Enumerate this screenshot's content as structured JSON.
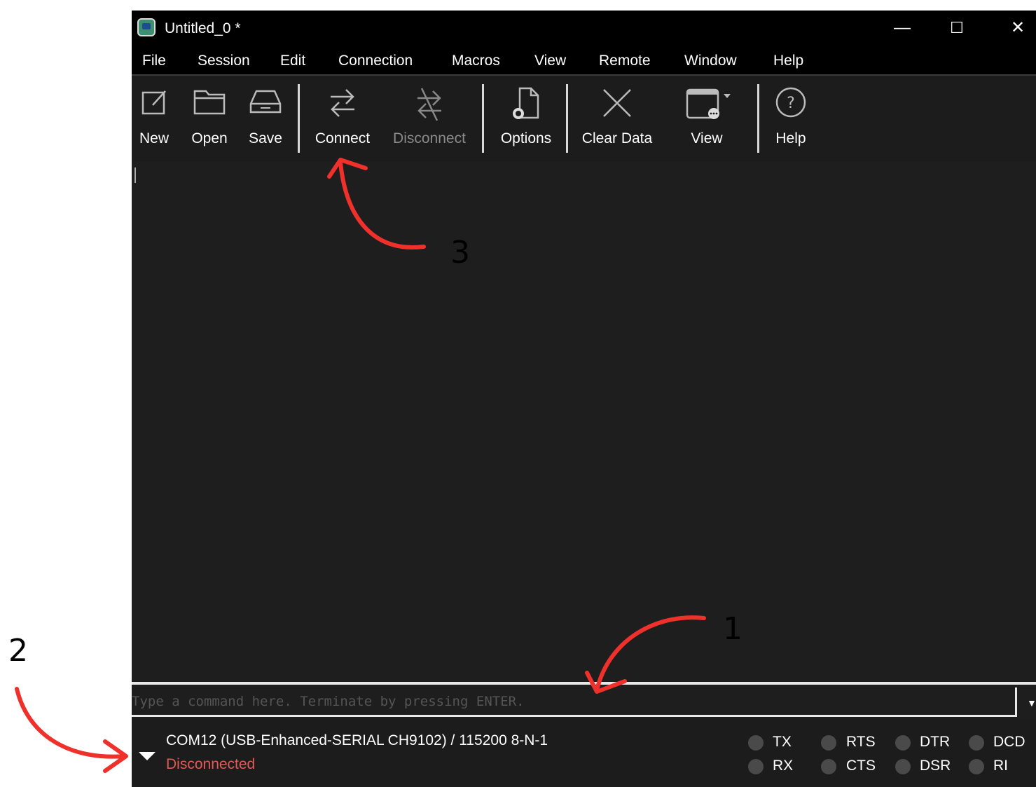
{
  "window": {
    "title": "Untitled_0 *",
    "controls": {
      "minimize": "—",
      "maximize": "☐",
      "close": "✕"
    }
  },
  "menu": [
    "File",
    "Session",
    "Edit",
    "Connection",
    "Macros",
    "View",
    "Remote",
    "Window",
    "Help"
  ],
  "toolbar": {
    "new": "New",
    "open": "Open",
    "save": "Save",
    "connect": "Connect",
    "disconnect": "Disconnect",
    "options": "Options",
    "clear_data": "Clear Data",
    "view": "View",
    "help": "Help"
  },
  "command": {
    "placeholder": "Type a command here. Terminate by pressing ENTER.",
    "value": ""
  },
  "status": {
    "port_info": "COM12 (USB-Enhanced-SERIAL CH9102) / 115200 8-N-1",
    "connection_state": "Disconnected",
    "indicators": [
      "TX",
      "RX",
      "RTS",
      "CTS",
      "DTR",
      "DSR",
      "DCD",
      "RI"
    ]
  },
  "annotations": {
    "label_1": "1",
    "label_2": "2",
    "label_3": "3"
  },
  "colors": {
    "accent_annotation": "#f0302b",
    "disconnected_text": "#e25b52",
    "led_off": "#4a4a4a"
  }
}
